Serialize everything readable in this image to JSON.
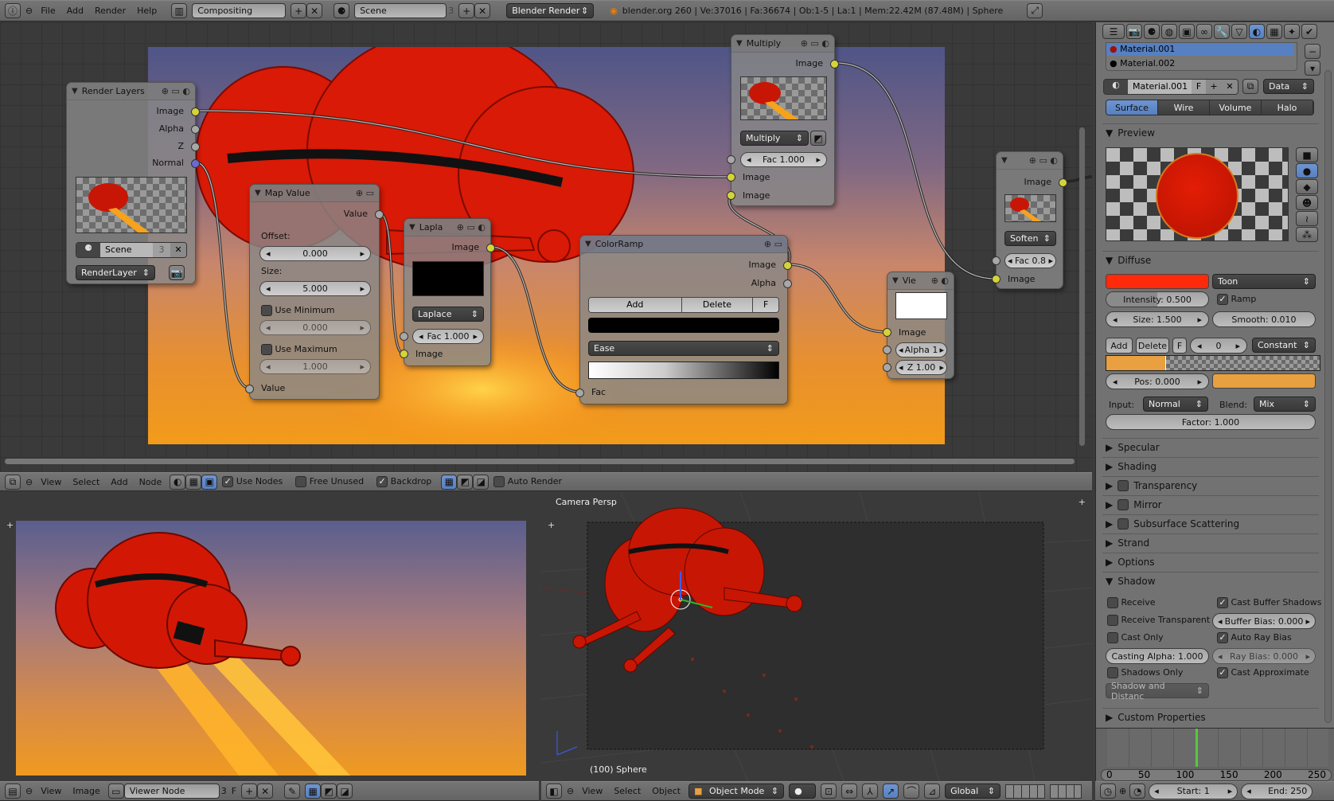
{
  "topbar": {
    "menus": [
      "File",
      "Add",
      "Render",
      "Help"
    ],
    "screen_layout": "Compositing",
    "scene": "Scene",
    "scene_users": "3",
    "render_engine": "Blender Render",
    "stats": "blender.org 260 | Ve:37016 | Fa:36674 | Ob:1-5 | La:1 | Mem:22.42M (87.48M) | Sphere"
  },
  "nodes": {
    "render_layers": {
      "title": "Render Layers",
      "outputs": [
        "Image",
        "Alpha",
        "Z",
        "Normal"
      ],
      "scene": "Scene",
      "scene_users": "3",
      "layer": "RenderLayer"
    },
    "map_value": {
      "title": "Map Value",
      "output": "Value",
      "offset_label": "Offset:",
      "offset": "0.000",
      "size_label": "Size:",
      "size": "5.000",
      "use_min": "Use Minimum",
      "min": "0.000",
      "use_max": "Use Maximum",
      "max": "1.000",
      "input": "Value"
    },
    "laplace": {
      "title": "Lapla",
      "output": "Image",
      "filter": "Laplace",
      "fac": "Fac 1.000",
      "input": "Image"
    },
    "colorramp": {
      "title": "ColorRamp",
      "outputs": [
        "Image",
        "Alpha"
      ],
      "add": "Add",
      "delete": "Delete",
      "flip": "F",
      "interpolation": "Ease",
      "input": "Fac"
    },
    "multiply": {
      "title": "Multiply",
      "output": "Image",
      "blend": "Multiply",
      "fac": "Fac 1.000",
      "inputs": [
        "Image",
        "Image"
      ]
    },
    "soften": {
      "title": "",
      "output": "Image",
      "filter": "Soften",
      "fac": "Fac 0.8",
      "input": "Image"
    },
    "viewer": {
      "title": "Vie",
      "input": "Image",
      "alpha": "Alpha 1",
      "z": "Z 1.00"
    }
  },
  "node_header": {
    "menus": [
      "View",
      "Select",
      "Add",
      "Node"
    ],
    "use_nodes": {
      "label": "Use Nodes",
      "checked": true
    },
    "free_unused": {
      "label": "Free Unused",
      "checked": false
    },
    "backdrop": {
      "label": "Backdrop",
      "checked": true
    },
    "auto_render": {
      "label": "Auto Render",
      "checked": false
    }
  },
  "image_editor": {
    "menus": [
      "View",
      "Image"
    ],
    "image": "Viewer Node",
    "users": "3",
    "fake": "F"
  },
  "viewport": {
    "view_label": "Camera Persp",
    "object_label": "(100) Sphere",
    "menus": [
      "View",
      "Select",
      "Object"
    ],
    "mode": "Object Mode",
    "orientation": "Global"
  },
  "properties": {
    "materials": [
      "Material.001",
      "Material.002"
    ],
    "material_name": "Material.001",
    "fake": "F",
    "link": "Data",
    "tabs": [
      "Surface",
      "Wire",
      "Volume",
      "Halo"
    ],
    "active_tab": "Surface",
    "preview": "Preview",
    "diffuse": {
      "title": "Diffuse",
      "color": "#ff2a0a",
      "shader": "Toon",
      "intensity": "Intensity: 0.500",
      "intensity_value": 0.5,
      "ramp": {
        "label": "Ramp",
        "checked": true
      },
      "size": "Size: 1.500",
      "smooth": "Smooth: 0.010",
      "add": "Add",
      "delete": "Delete",
      "flip": "F",
      "index": "0",
      "interpolation": "Constant",
      "pos": "Pos: 0.000",
      "ramp_color": "#e8a040",
      "input_label": "Input:",
      "input": "Normal",
      "blend_label": "Blend:",
      "blend": "Mix",
      "factor": "Factor: 1.000"
    },
    "sections": [
      "Specular",
      "Shading",
      "Transparency",
      "Mirror",
      "Subsurface Scattering",
      "Strand",
      "Options",
      "Shadow"
    ],
    "shadow": {
      "receive": {
        "label": "Receive",
        "checked": false
      },
      "receive_transparent": {
        "label": "Receive Transparent",
        "checked": false
      },
      "cast_only": {
        "label": "Cast Only",
        "checked": false
      },
      "casting_alpha": "Casting Alpha: 1.000",
      "shadows_only": {
        "label": "Shadows Only",
        "checked": false
      },
      "shadows_only_mode": "Shadow and Distanc",
      "cast_buffer": {
        "label": "Cast Buffer Shadows",
        "checked": true
      },
      "buffer_bias": "Buffer Bias: 0.000",
      "auto_ray_bias": {
        "label": "Auto Ray Bias",
        "checked": true
      },
      "ray_bias": "Ray Bias: 0.000",
      "cast_approximate": {
        "label": "Cast Approximate",
        "checked": true
      }
    },
    "custom_properties": "Custom Properties"
  },
  "timeline": {
    "ticks": [
      "0",
      "50",
      "100",
      "150",
      "200",
      "250"
    ],
    "current_frame": 100,
    "start": "Start: 1",
    "end": "End: 250"
  }
}
